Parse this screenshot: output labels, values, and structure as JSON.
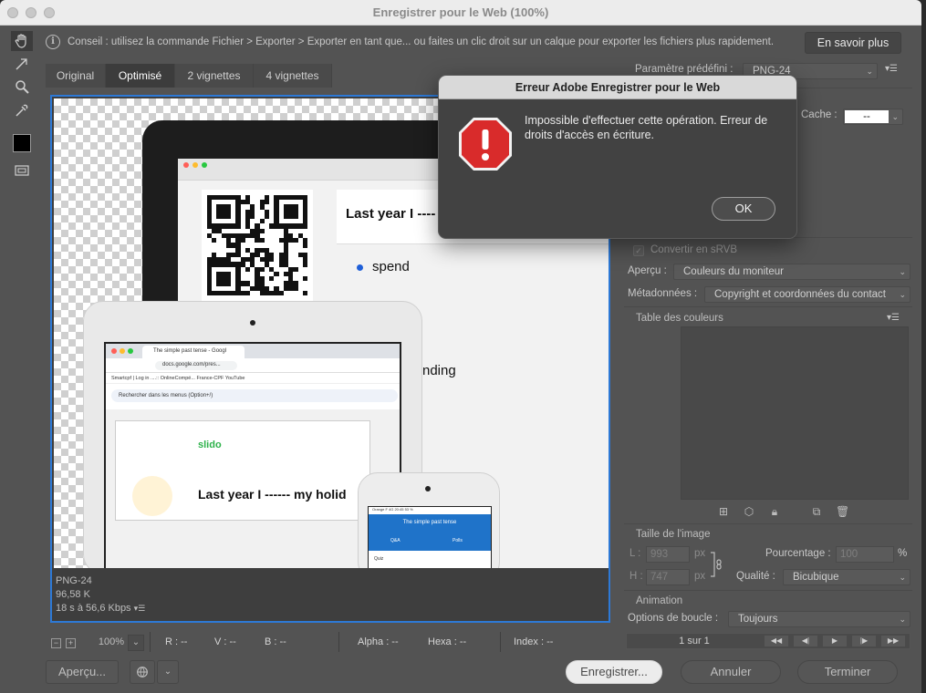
{
  "window": {
    "title": "Enregistrer pour le Web (100%)"
  },
  "tip": {
    "text": "Conseil : utilisez la commande Fichier > Exporter > Exporter en tant que... ou faites un clic droit sur un calque pour exporter les fichiers plus rapidement.",
    "learn_more": "En savoir plus"
  },
  "tabs": [
    {
      "label": "Original"
    },
    {
      "label": "Optimisé"
    },
    {
      "label": "2 vignettes"
    },
    {
      "label": "4 vignettes"
    }
  ],
  "canvas_info": {
    "format": "PNG-24",
    "size": "96,58 K",
    "time": "18 s à 56,6 Kbps"
  },
  "preview_image": {
    "slide_title": "Last year I ----",
    "option_1": "spend",
    "option_2": "nding",
    "browser_tab": "The simple past tense - Googl",
    "url": "docs.google.com/pres...",
    "bookmarks": "Smartcpf | Log in   ....:: OnlineCompé...   France-CPF   YouTube",
    "docs_menu": "Rechercher dans les menus (Option+/)",
    "slido": "slido",
    "big_line": "Last year I ------ my holid",
    "phone_status": "Orange F 4G         20:45              53 %",
    "phone_title": "The simple past tense",
    "phone_tab_qa": "Q&A",
    "phone_tab_polls": "Polls",
    "phone_quiz": "Quiz"
  },
  "statusbar": {
    "zoom": "100%",
    "r": "R : --",
    "g": "V : --",
    "b": "B : --",
    "alpha": "Alpha : --",
    "hex": "Hexa : --",
    "index": "Index : --"
  },
  "buttons": {
    "preview": "Aperçu...",
    "save": "Enregistrer...",
    "cancel": "Annuler",
    "done": "Terminer"
  },
  "panel": {
    "preset_label": "Paramètre prédéfini :",
    "preset_value": "PNG-24",
    "cache_label": "Cache :",
    "cache_value": "--",
    "srgb": "Convertir en sRVB",
    "preview_label": "Aperçu :",
    "preview_value": "Couleurs du moniteur",
    "metadata_label": "Métadonnées :",
    "metadata_value": "Copyright et coordonnées du contact",
    "color_table": "Table des couleurs",
    "image_size": "Taille de l'image",
    "w_label": "L :",
    "w_value": "993",
    "h_label": "H :",
    "h_value": "747",
    "px": "px",
    "percent_label": "Pourcentage :",
    "percent_value": "100",
    "percent_unit": "%",
    "quality_label": "Qualité :",
    "quality_value": "Bicubique",
    "animation": "Animation",
    "loop_label": "Options de boucle :",
    "loop_value": "Toujours",
    "frame": "1 sur 1"
  },
  "dialog": {
    "title": "Erreur Adobe Enregistrer pour le Web",
    "message": "Impossible d'effectuer cette opération. Erreur de droits d'accès en écriture.",
    "ok": "OK"
  },
  "colors": {
    "accent": "#2d79d6",
    "error": "#d92b2b",
    "success_green": "#2db24a"
  }
}
